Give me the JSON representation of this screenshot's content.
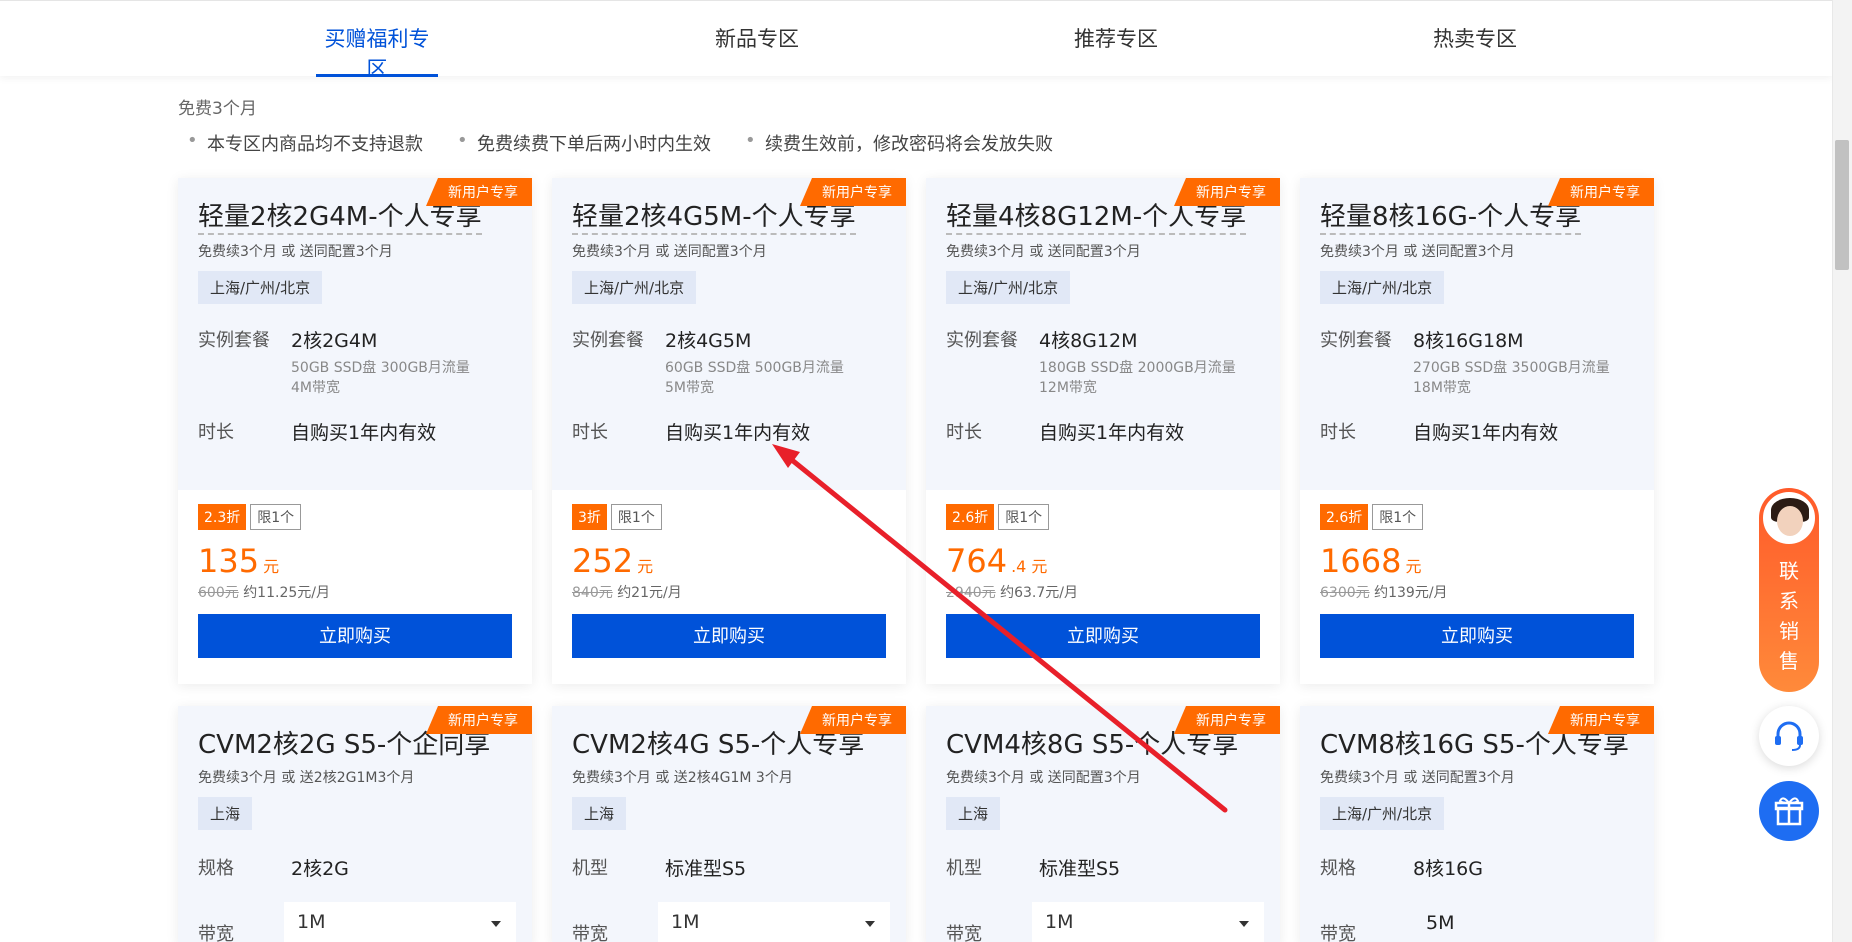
{
  "tabs": [
    {
      "label": "买赠福利专区",
      "active": true
    },
    {
      "label": "新品专区",
      "active": false
    },
    {
      "label": "推荐专区",
      "active": false
    },
    {
      "label": "热卖专区",
      "active": false
    }
  ],
  "subtitle": "免费3个月",
  "notes": [
    "本专区内商品均不支持退款",
    "免费续费下单后两小时内生效",
    "续费生效前，修改密码将会发放失败"
  ],
  "ribbon": "新用户专享",
  "buy_label": "立即购买",
  "cards_row1": [
    {
      "title": "轻量2核2G4M-个人专享",
      "sub": "免费续3个月 或 送同配置3个月",
      "region": "上海/广州/北京",
      "spec_label": "实例套餐",
      "spec": "2核2G4M",
      "detail1": "50GB SSD盘 300GB月流量",
      "detail2": "4M带宽",
      "dur_label": "时长",
      "dur": "自购买1年内有效",
      "discount": "2.3折",
      "limit": "限1个",
      "price": "135",
      "price_unit": "元",
      "orig": "600元",
      "monthly": "约11.25元/月"
    },
    {
      "title": "轻量2核4G5M-个人专享",
      "sub": "免费续3个月 或 送同配置3个月",
      "region": "上海/广州/北京",
      "spec_label": "实例套餐",
      "spec": "2核4G5M",
      "detail1": "60GB SSD盘 500GB月流量",
      "detail2": "5M带宽",
      "dur_label": "时长",
      "dur": "自购买1年内有效",
      "discount": "3折",
      "limit": "限1个",
      "price": "252",
      "price_unit": "元",
      "orig": "840元",
      "monthly": "约21元/月"
    },
    {
      "title": "轻量4核8G12M-个人专享",
      "sub": "免费续3个月 或 送同配置3个月",
      "region": "上海/广州/北京",
      "spec_label": "实例套餐",
      "spec": "4核8G12M",
      "detail1": "180GB SSD盘 2000GB月流量",
      "detail2": "12M带宽",
      "dur_label": "时长",
      "dur": "自购买1年内有效",
      "discount": "2.6折",
      "limit": "限1个",
      "price": "764",
      "price_unit": ".4 元",
      "orig": "2940元",
      "monthly": "约63.7元/月"
    },
    {
      "title": "轻量8核16G-个人专享",
      "sub": "免费续3个月 或 送同配置3个月",
      "region": "上海/广州/北京",
      "spec_label": "实例套餐",
      "spec": "8核16G18M",
      "detail1": "270GB SSD盘 3500GB月流量",
      "detail2": "18M带宽",
      "dur_label": "时长",
      "dur": "自购买1年内有效",
      "discount": "2.6折",
      "limit": "限1个",
      "price": "1668",
      "price_unit": "元",
      "orig": "6300元",
      "monthly": "约139元/月"
    }
  ],
  "cards_row2": [
    {
      "title": "CVM2核2G S5-个企同享",
      "sub": "免费续3个月 或 送2核2G1M3个月",
      "region": "上海",
      "spec_label": "规格",
      "spec": "2核2G",
      "bw_label": "带宽",
      "bw": "1M",
      "bw_select": true
    },
    {
      "title": "CVM2核4G S5-个人专享",
      "sub": "免费续3个月 或 送2核4G1M 3个月",
      "region": "上海",
      "spec_label": "机型",
      "spec": "标准型S5",
      "bw_label": "带宽",
      "bw": "1M",
      "bw_select": true
    },
    {
      "title": "CVM4核8G S5-个人专享",
      "sub": "免费续3个月 或 送同配置3个月",
      "region": "上海",
      "spec_label": "机型",
      "spec": "标准型S5",
      "bw_label": "带宽",
      "bw": "1M",
      "bw_select": true
    },
    {
      "title": "CVM8核16G S5-个人专享",
      "sub": "免费续3个月 或 送同配置3个月",
      "region": "上海/广州/北京",
      "spec_label": "规格",
      "spec": "8核16G",
      "bw_label": "带宽",
      "bw": "5M",
      "bw_select": false
    }
  ],
  "sales": {
    "text": [
      "联",
      "系",
      "销",
      "售"
    ]
  },
  "colors": {
    "accent": "#0052d9",
    "orange": "#ff6a00",
    "annotation_arrow": "#e8202a"
  }
}
